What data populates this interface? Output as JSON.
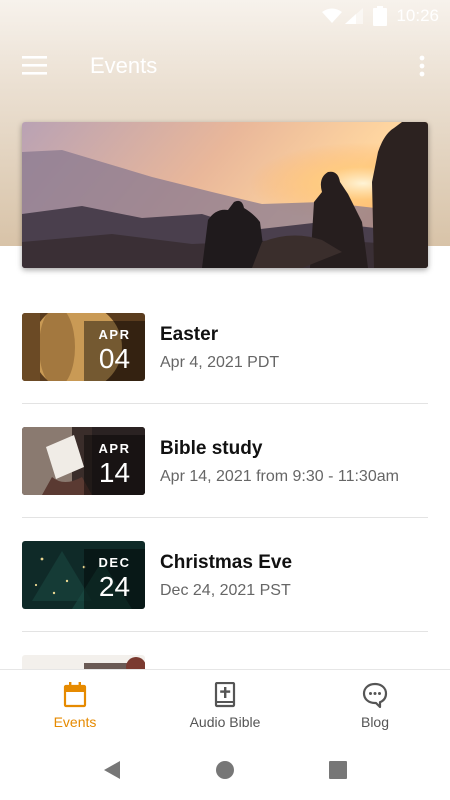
{
  "status_bar": {
    "time": "10:26"
  },
  "app_bar": {
    "title": "Events"
  },
  "events": [
    {
      "month": "APR",
      "day": "04",
      "name": "Easter",
      "when": "Apr 4, 2021 PDT"
    },
    {
      "month": "APR",
      "day": "14",
      "name": "Bible study",
      "when": "Apr 14, 2021 from 9:30 - 11:30am"
    },
    {
      "month": "DEC",
      "day": "24",
      "name": "Christmas Eve",
      "when": "Dec 24, 2021 PST"
    }
  ],
  "bottom_nav": {
    "items": [
      {
        "label": "Events",
        "icon": "calendar-icon",
        "active": true
      },
      {
        "label": "Audio Bible",
        "icon": "bible-icon",
        "active": false
      },
      {
        "label": "Blog",
        "icon": "chat-icon",
        "active": false
      }
    ]
  },
  "colors": {
    "accent": "#e68a00",
    "nav_inactive": "#555555",
    "header_tan": "#d8c3a8"
  }
}
